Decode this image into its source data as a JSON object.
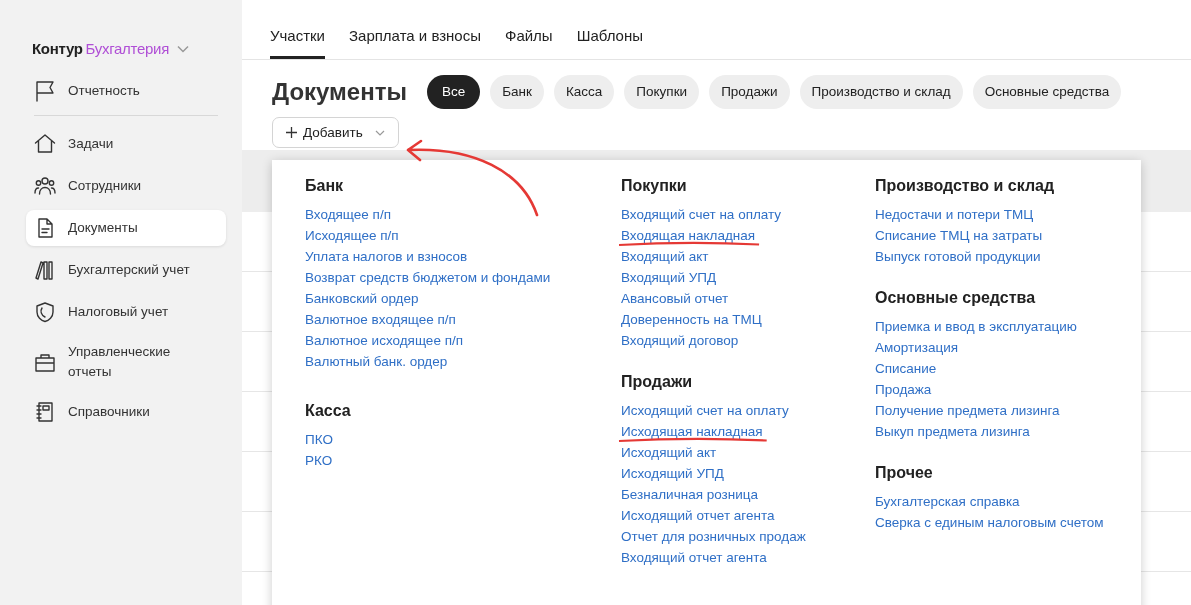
{
  "sidebar": {
    "logo": {
      "brand": "Контур",
      "product": "Бухгалтерия"
    },
    "items": [
      {
        "label": "Отчетность",
        "selected": false
      },
      {
        "label": "Задачи",
        "selected": false
      },
      {
        "label": "Сотрудники",
        "selected": false
      },
      {
        "label": "Документы",
        "selected": true
      },
      {
        "label": "Бухгалтерский учет",
        "selected": false
      },
      {
        "label": "Налоговый учет",
        "selected": false
      },
      {
        "label": "Управленческие отчеты",
        "selected": false
      },
      {
        "label": "Справочники",
        "selected": false
      }
    ]
  },
  "tabs": [
    {
      "label": "Участки",
      "selected": true
    },
    {
      "label": "Зарплата и взносы",
      "selected": false
    },
    {
      "label": "Файлы",
      "selected": false
    },
    {
      "label": "Шаблоны",
      "selected": false
    }
  ],
  "page_title": "Документы",
  "filters": [
    {
      "label": "Все",
      "selected": true
    },
    {
      "label": "Банк",
      "selected": false
    },
    {
      "label": "Касса",
      "selected": false
    },
    {
      "label": "Покупки",
      "selected": false
    },
    {
      "label": "Продажи",
      "selected": false
    },
    {
      "label": "Производство и склад",
      "selected": false
    },
    {
      "label": "Основные средства",
      "selected": false
    }
  ],
  "add_button": "Добавить",
  "add_menu": {
    "columns": [
      [
        {
          "title": "Банк",
          "items": [
            {
              "label": "Входящее п/п",
              "annotated": false
            },
            {
              "label": "Исходящее п/п",
              "annotated": false
            },
            {
              "label": "Уплата налогов и взносов",
              "annotated": false
            },
            {
              "label": "Возврат средств бюджетом и фондами",
              "annotated": false
            },
            {
              "label": "Банковский ордер",
              "annotated": false
            },
            {
              "label": "Валютное входящее п/п",
              "annotated": false
            },
            {
              "label": "Валютное исходящее п/п",
              "annotated": false
            },
            {
              "label": "Валютный банк. ордер",
              "annotated": false
            }
          ]
        },
        {
          "title": "Касса",
          "items": [
            {
              "label": "ПКО",
              "annotated": false
            },
            {
              "label": "РКО",
              "annotated": false
            }
          ]
        }
      ],
      [
        {
          "title": "Покупки",
          "items": [
            {
              "label": "Входящий счет на оплату",
              "annotated": false
            },
            {
              "label": "Входящая накладная",
              "annotated": true
            },
            {
              "label": "Входящий акт",
              "annotated": false
            },
            {
              "label": "Входящий УПД",
              "annotated": false
            },
            {
              "label": "Авансовый отчет",
              "annotated": false
            },
            {
              "label": "Доверенность на ТМЦ",
              "annotated": false
            },
            {
              "label": "Входящий договор",
              "annotated": false
            }
          ]
        },
        {
          "title": "Продажи",
          "items": [
            {
              "label": "Исходящий счет на оплату",
              "annotated": false
            },
            {
              "label": "Исходящая накладная",
              "annotated": true
            },
            {
              "label": "Исходящий акт",
              "annotated": false
            },
            {
              "label": "Исходящий УПД",
              "annotated": false
            },
            {
              "label": "Безналичная розница",
              "annotated": false
            },
            {
              "label": "Исходящий отчет агента",
              "annotated": false
            },
            {
              "label": "Отчет для розничных продаж",
              "annotated": false
            },
            {
              "label": "Входящий отчет агента",
              "annotated": false
            }
          ]
        }
      ],
      [
        {
          "title": "Производство и склад",
          "items": [
            {
              "label": "Недостачи и потери ТМЦ",
              "annotated": false
            },
            {
              "label": "Списание ТМЦ на затраты",
              "annotated": false
            },
            {
              "label": "Выпуск готовой продукции",
              "annotated": false
            }
          ]
        },
        {
          "title": "Основные средства",
          "items": [
            {
              "label": "Приемка и ввод в эксплуатацию",
              "annotated": false
            },
            {
              "label": "Амортизация",
              "annotated": false
            },
            {
              "label": "Списание",
              "annotated": false
            },
            {
              "label": "Продажа",
              "annotated": false
            },
            {
              "label": "Получение предмета лизинга",
              "annotated": false
            },
            {
              "label": "Выкуп предмета лизинга",
              "annotated": false
            }
          ]
        },
        {
          "title": "Прочее",
          "items": [
            {
              "label": "Бухгалтерская справка",
              "annotated": false
            },
            {
              "label": "Сверка с единым налоговым счетом",
              "annotated": false
            }
          ]
        }
      ]
    ]
  }
}
